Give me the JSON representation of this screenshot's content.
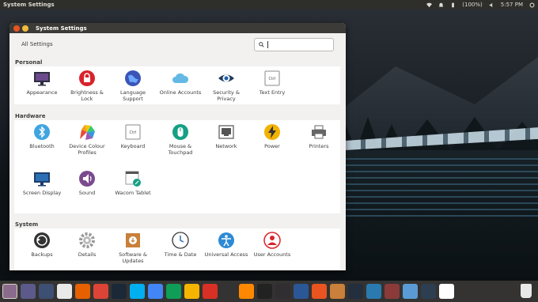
{
  "top_panel": {
    "app_title": "System Settings",
    "battery": "(100%)",
    "time": "5:57 PM",
    "icons": [
      "wifi-icon",
      "notification-icon",
      "battery-icon",
      "volume-icon",
      "power-gear-icon"
    ]
  },
  "window": {
    "title": "System Settings",
    "all_settings": "All Settings",
    "search_placeholder": ""
  },
  "sections": [
    {
      "title": "Personal",
      "items": [
        {
          "label": "Appearance",
          "icon": "appearance-icon",
          "color": "#2e2e42"
        },
        {
          "label": "Brightness & Lock",
          "icon": "lock-icon",
          "color": "#d9232b"
        },
        {
          "label": "Language Support",
          "icon": "globe-icon",
          "color": "#3b55b7"
        },
        {
          "label": "Online Accounts",
          "icon": "cloud-icon",
          "color": "#63b9e4"
        },
        {
          "label": "Security & Privacy",
          "icon": "eye-icon",
          "color": "#1f5ea8"
        },
        {
          "label": "Text Entry",
          "icon": "ctrl-key-icon",
          "color": "#888888"
        }
      ]
    },
    {
      "title": "Hardware",
      "items": [
        {
          "label": "Bluetooth",
          "icon": "bluetooth-icon",
          "color": "#3ea5e0"
        },
        {
          "label": "Device Colour Profiles",
          "icon": "color-profile-icon",
          "color": "#f0a030"
        },
        {
          "label": "Keyboard",
          "icon": "keyboard-icon",
          "color": "#888888"
        },
        {
          "label": "Mouse & Touchpad",
          "icon": "mouse-icon",
          "color": "#16a085"
        },
        {
          "label": "Network",
          "icon": "network-icon",
          "color": "#555555"
        },
        {
          "label": "Power",
          "icon": "power-icon",
          "color": "#f2b200"
        },
        {
          "label": "Printers",
          "icon": "printer-icon",
          "color": "#666666"
        },
        {
          "label": "Screen Display",
          "icon": "monitor-icon",
          "color": "#2d6fb4"
        },
        {
          "label": "Sound",
          "icon": "speaker-icon",
          "color": "#7a4a8e"
        },
        {
          "label": "Wacom Tablet",
          "icon": "tablet-icon",
          "color": "#16a085"
        }
      ]
    },
    {
      "title": "System",
      "items": [
        {
          "label": "Backups",
          "icon": "backup-icon",
          "color": "#333333"
        },
        {
          "label": "Details",
          "icon": "gear-icon",
          "color": "#999999"
        },
        {
          "label": "Software & Updates",
          "icon": "software-box-icon",
          "color": "#c8803a"
        },
        {
          "label": "Time & Date",
          "icon": "clock-icon",
          "color": "#2d6fb4"
        },
        {
          "label": "Universal Access",
          "icon": "accessibility-icon",
          "color": "#2d8ad6"
        },
        {
          "label": "User Accounts",
          "icon": "user-icon",
          "color": "#d9232b"
        }
      ]
    }
  ],
  "dock": [
    {
      "icon": "ubuntu-dash-icon",
      "color": "#8a6b8c"
    },
    {
      "icon": "workspace-icon",
      "color": "#5b5a8a"
    },
    {
      "icon": "desktop-icon",
      "color": "#3d4f72"
    },
    {
      "icon": "files-icon",
      "color": "#e9e9e9"
    },
    {
      "icon": "firefox-icon",
      "color": "#e66000"
    },
    {
      "icon": "chrome-icon",
      "color": "#db4437"
    },
    {
      "icon": "steam-icon",
      "color": "#1b2838"
    },
    {
      "icon": "skype-icon",
      "color": "#00aff0"
    },
    {
      "icon": "docs-icon",
      "color": "#4285f4"
    },
    {
      "icon": "sheets-icon",
      "color": "#0f9d58"
    },
    {
      "icon": "slides-icon",
      "color": "#f4b400"
    },
    {
      "icon": "pdf-icon",
      "color": "#d93025"
    },
    {
      "icon": "inkscape-icon",
      "color": "#333333"
    },
    {
      "icon": "vlc-icon",
      "color": "#ff8800"
    },
    {
      "icon": "terminal-dark-icon",
      "color": "#222222"
    },
    {
      "icon": "obs-icon",
      "color": "#302e31"
    },
    {
      "icon": "disk-icon",
      "color": "#2b5797"
    },
    {
      "icon": "store-icon",
      "color": "#e95420"
    },
    {
      "icon": "package-icon",
      "color": "#c8803a"
    },
    {
      "icon": "amazon-icon",
      "color": "#232f3e"
    },
    {
      "icon": "mixer-icon",
      "color": "#2a7ab0"
    },
    {
      "icon": "equalizer-icon",
      "color": "#8b3a3a"
    },
    {
      "icon": "folder-icon",
      "color": "#5a9bd5"
    },
    {
      "icon": "terminal-icon",
      "color": "#2c3e50"
    },
    {
      "icon": "app-icon",
      "color": "#ffffff"
    }
  ]
}
